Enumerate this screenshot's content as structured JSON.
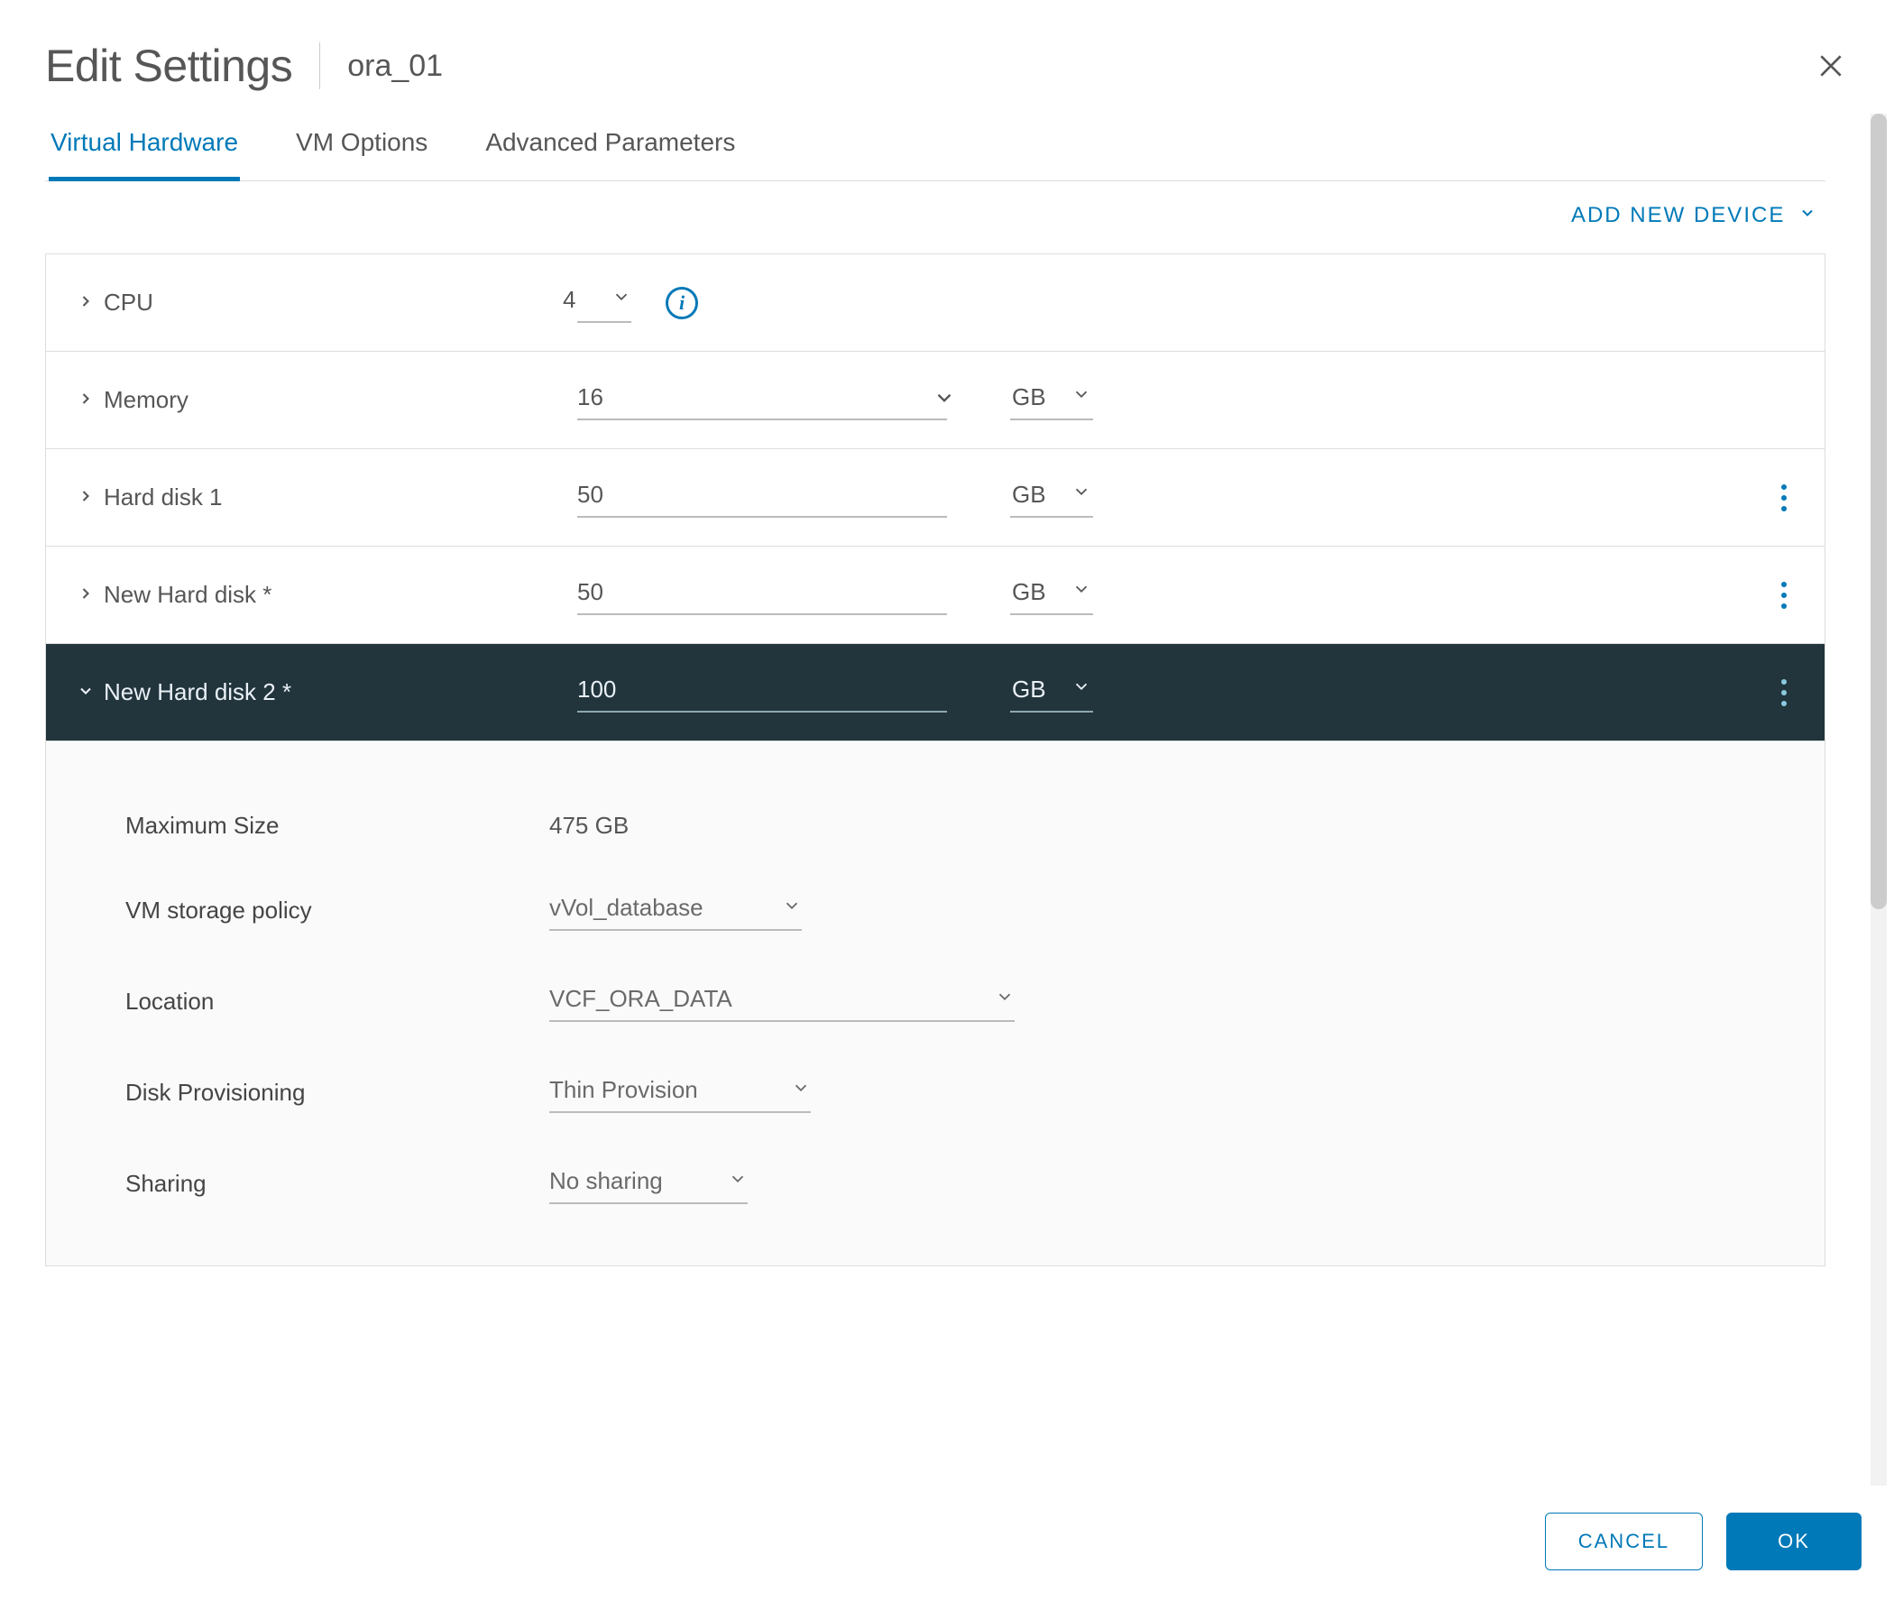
{
  "header": {
    "title": "Edit Settings",
    "subtitle": "ora_01"
  },
  "tabs": [
    {
      "label": "Virtual Hardware",
      "active": true
    },
    {
      "label": "VM Options",
      "active": false
    },
    {
      "label": "Advanced Parameters",
      "active": false
    }
  ],
  "add_device": "ADD NEW DEVICE",
  "hardware": {
    "cpu": {
      "label": "CPU",
      "value": "4"
    },
    "memory": {
      "label": "Memory",
      "value": "16",
      "unit": "GB"
    },
    "hd1": {
      "label": "Hard disk 1",
      "value": "50",
      "unit": "GB"
    },
    "hd_new1": {
      "label": "New Hard disk *",
      "value": "50",
      "unit": "GB"
    },
    "hd_new2": {
      "label": "New Hard disk 2 *",
      "value": "100",
      "unit": "GB"
    }
  },
  "disk_detail": {
    "max_size": {
      "label": "Maximum Size",
      "value": "475 GB"
    },
    "storage_policy": {
      "label": "VM storage policy",
      "value": "vVol_database"
    },
    "location": {
      "label": "Location",
      "value": "VCF_ORA_DATA"
    },
    "provisioning": {
      "label": "Disk Provisioning",
      "value": "Thin Provision"
    },
    "sharing": {
      "label": "Sharing",
      "value": "No sharing"
    }
  },
  "footer": {
    "cancel": "CANCEL",
    "ok": "OK"
  }
}
